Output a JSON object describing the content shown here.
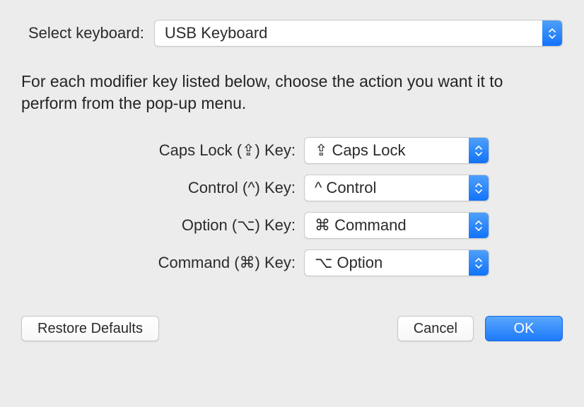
{
  "top": {
    "label": "Select keyboard:",
    "value": "USB Keyboard"
  },
  "instruction": "For each modifier key listed below, choose the action you want it to perform from the pop-up menu.",
  "rows": [
    {
      "label": "Caps Lock (⇪) Key:",
      "value": "⇪ Caps Lock"
    },
    {
      "label": "Control (^) Key:",
      "value": "^ Control"
    },
    {
      "label": "Option (⌥) Key:",
      "value": "⌘ Command"
    },
    {
      "label": "Command (⌘) Key:",
      "value": "⌥ Option"
    }
  ],
  "buttons": {
    "restore": "Restore Defaults",
    "cancel": "Cancel",
    "ok": "OK"
  }
}
